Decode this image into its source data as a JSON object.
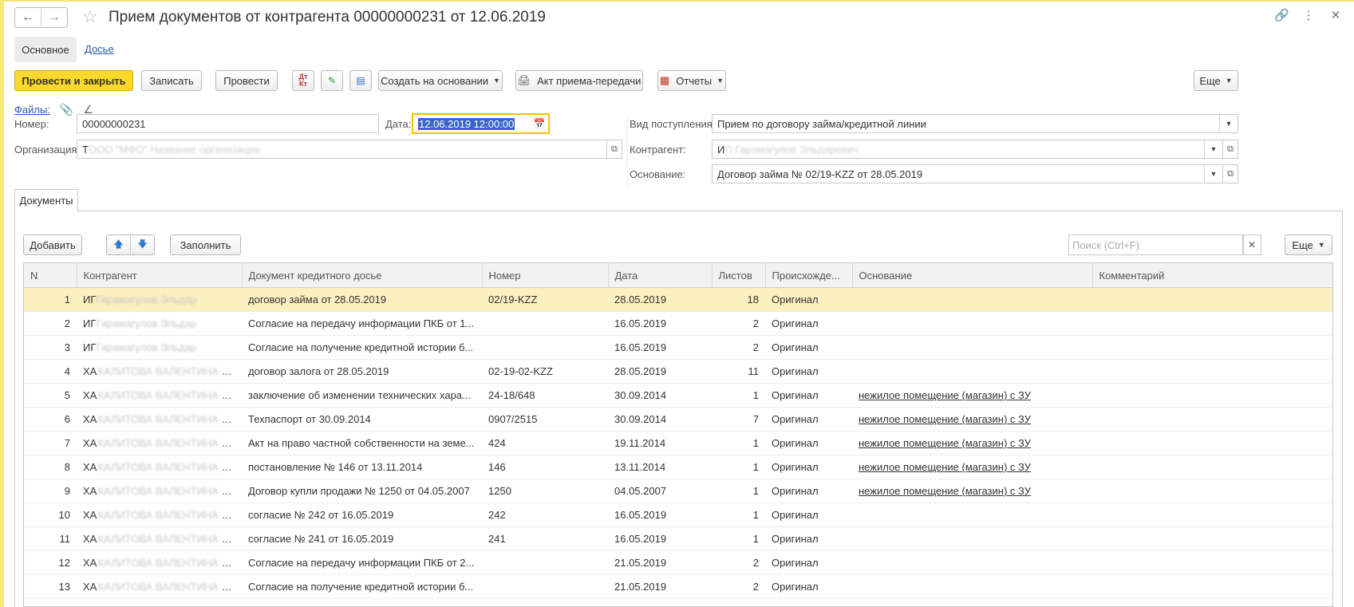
{
  "window": {
    "title": "Прием документов от контрагента 00000000231 от 12.06.2019"
  },
  "section_tabs": {
    "main": "Основное",
    "dossier": "Досье"
  },
  "toolbar": {
    "post_and_close": "Провести и закрыть",
    "save": "Записать",
    "post": "Провести",
    "dt_kt_top": "Дт",
    "dt_kt_bottom": "Кт",
    "create_based_on": "Создать на основании",
    "acceptance_act": "Акт приема-передачи",
    "reports": "Отчеты",
    "more": "Еще"
  },
  "files": {
    "label": "Файлы:"
  },
  "form": {
    "number_label": "Номер:",
    "number_value": "00000000231",
    "date_label": "Дата:",
    "date_value": "12.06.2019 12:00:00",
    "organization_label": "Организация:",
    "organization_prefix": "Т",
    "organization_blurred": "ООО \"МФО\" Название организации",
    "receipt_type_label": "Вид поступления:",
    "receipt_type_value": "Прием по договору займа/кредитной линии",
    "counterparty_label": "Контрагент:",
    "counterparty_prefix": "И",
    "counterparty_blurred": "П Гарамагулов Эльдарович",
    "basis_label": "Основание:",
    "basis_value": "Договор займа № 02/19-KZZ от 28.05.2019"
  },
  "documents_tab": {
    "label": "Документы",
    "add_button": "Добавить",
    "fill_button": "Заполнить",
    "search_placeholder": "Поиск (Ctrl+F)",
    "more_button": "Еще"
  },
  "table": {
    "columns": [
      "N",
      "Контрагент",
      "Документ кредитного досье",
      "Номер",
      "Дата",
      "Листов",
      "Происхожде...",
      "Основание",
      "Комментарий"
    ],
    "rows": [
      {
        "n": "1",
        "cp": "ИГ",
        "cp_blur": "Гарамагулов Эльдар",
        "cp_tail": "",
        "doc": "договор займа от 28.05.2019",
        "num": "02/19-KZZ",
        "date": "28.05.2019",
        "sheets": "18",
        "origin": "Оригинал",
        "basis": "",
        "comment": ""
      },
      {
        "n": "2",
        "cp": "ИГ",
        "cp_blur": "Гарамагулов Эльдар",
        "cp_tail": "",
        "doc": "Согласие на передачу информации ПКБ от 1...",
        "num": "",
        "date": "16.05.2019",
        "sheets": "2",
        "origin": "Оригинал",
        "basis": "",
        "comment": ""
      },
      {
        "n": "3",
        "cp": "ИГ",
        "cp_blur": "Гарамагулов Эльдар",
        "cp_tail": "",
        "doc": "Согласие на получение кредитной истории б...",
        "num": "",
        "date": "16.05.2019",
        "sheets": "2",
        "origin": "Оригинал",
        "basis": "",
        "comment": ""
      },
      {
        "n": "4",
        "cp": "ХА",
        "cp_blur": "ХАЛИТОВА ВАЛЕНТИНА ФИО",
        "cp_tail": "...",
        "doc": "договор залога от 28.05.2019",
        "num": "02-19-02-KZZ",
        "date": "28.05.2019",
        "sheets": "11",
        "origin": "Оригинал",
        "basis": "",
        "comment": ""
      },
      {
        "n": "5",
        "cp": "ХА",
        "cp_blur": "ХАЛИТОВА ВАЛЕНТИНА ФИО",
        "cp_tail": "...",
        "doc": "заключение об изменении технических хара...",
        "num": "24-18/648",
        "date": "30.09.2014",
        "sheets": "1",
        "origin": "Оригинал",
        "basis": "нежилое помещение (магазин) с ЗУ",
        "comment": ""
      },
      {
        "n": "6",
        "cp": "ХА",
        "cp_blur": "ХАЛИТОВА ВАЛЕНТИНА ФИО",
        "cp_tail": "...",
        "doc": "Техпаспорт от 30.09.2014",
        "num": "0907/2515",
        "date": "30.09.2014",
        "sheets": "7",
        "origin": "Оригинал",
        "basis": "нежилое помещение (магазин) с ЗУ",
        "comment": ""
      },
      {
        "n": "7",
        "cp": "ХА",
        "cp_blur": "ХАЛИТОВА ВАЛЕНТИНА ФИО",
        "cp_tail": "...",
        "doc": "Акт на право частной собственности на земе...",
        "num": "424",
        "date": "19.11.2014",
        "sheets": "1",
        "origin": "Оригинал",
        "basis": "нежилое помещение (магазин) с ЗУ",
        "comment": ""
      },
      {
        "n": "8",
        "cp": "ХА",
        "cp_blur": "ХАЛИТОВА ВАЛЕНТИНА ФИО",
        "cp_tail": "...",
        "doc": "постановление № 146 от 13.11.2014",
        "num": "146",
        "date": "13.11.2014",
        "sheets": "1",
        "origin": "Оригинал",
        "basis": "нежилое помещение (магазин) с ЗУ",
        "comment": ""
      },
      {
        "n": "9",
        "cp": "ХА",
        "cp_blur": "ХАЛИТОВА ВАЛЕНТИНА ФИО",
        "cp_tail": "...",
        "doc": "Договор купли продажи № 1250 от 04.05.2007",
        "num": "1250",
        "date": "04.05.2007",
        "sheets": "1",
        "origin": "Оригинал",
        "basis": "нежилое помещение (магазин) с ЗУ",
        "comment": ""
      },
      {
        "n": "10",
        "cp": "ХА",
        "cp_blur": "ХАЛИТОВА ВАЛЕНТИНА ФИО",
        "cp_tail": "...",
        "doc": "согласие № 242 от 16.05.2019",
        "num": "242",
        "date": "16.05.2019",
        "sheets": "1",
        "origin": "Оригинал",
        "basis": "",
        "comment": ""
      },
      {
        "n": "11",
        "cp": "ХА",
        "cp_blur": "ХАЛИТОВА ВАЛЕНТИНА ФИО",
        "cp_tail": "...",
        "doc": "согласие № 241 от 16.05.2019",
        "num": "241",
        "date": "16.05.2019",
        "sheets": "1",
        "origin": "Оригинал",
        "basis": "",
        "comment": ""
      },
      {
        "n": "12",
        "cp": "ХА",
        "cp_blur": "ХАЛИТОВА ВАЛЕНТИНА ФИО",
        "cp_tail": "...",
        "doc": "Согласие на передачу информации ПКБ от 2...",
        "num": "",
        "date": "21.05.2019",
        "sheets": "2",
        "origin": "Оригинал",
        "basis": "",
        "comment": ""
      },
      {
        "n": "13",
        "cp": "ХА",
        "cp_blur": "ХАЛИТОВА ВАЛЕНТИНА ФИО",
        "cp_tail": "...",
        "doc": "Согласие на получение кредитной истории б...",
        "num": "",
        "date": "21.05.2019",
        "sheets": "2",
        "origin": "Оригинал",
        "basis": "",
        "comment": ""
      }
    ],
    "selected_row": 0
  },
  "colors": {
    "primary_button": "#fbd92c",
    "selected_row": "#fcefc0",
    "link": "#2a5ca8",
    "date_focus": "#f2c200",
    "selection": "#3b66c7"
  }
}
